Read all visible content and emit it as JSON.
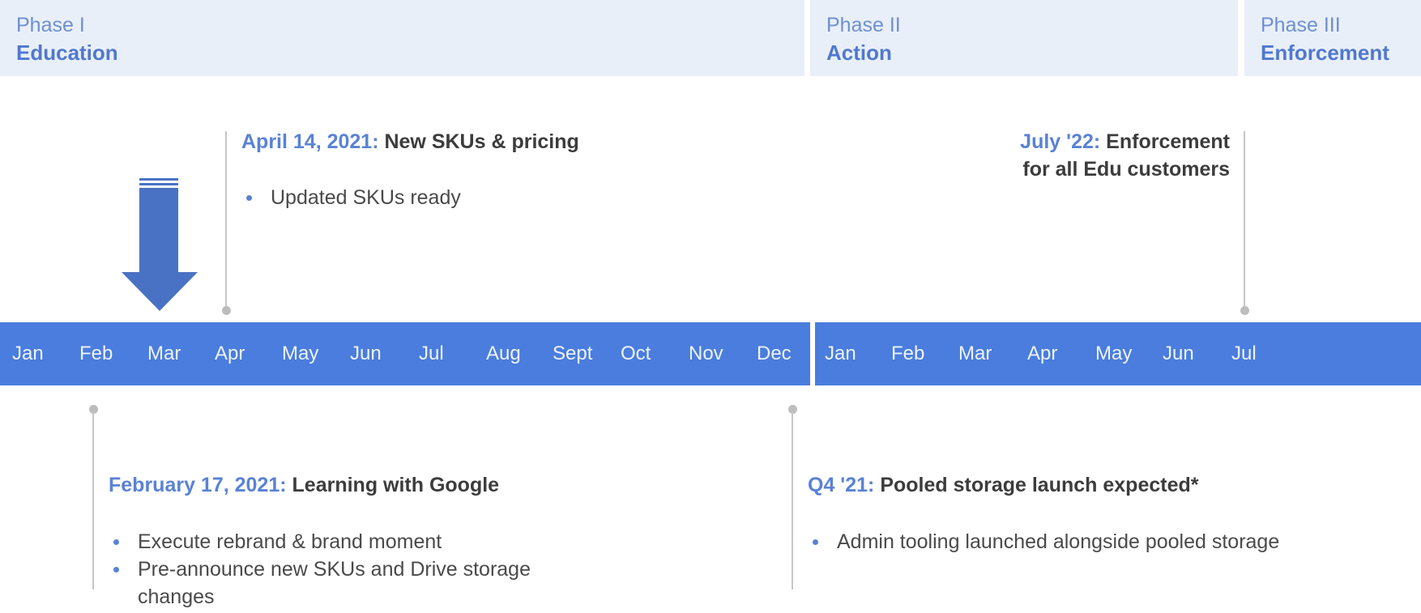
{
  "phases": [
    {
      "number": "Phase I",
      "name": "Education"
    },
    {
      "number": "Phase II",
      "name": "Action"
    },
    {
      "number": "Phase III",
      "name": "Enforcement"
    }
  ],
  "timeline": {
    "year1_months": [
      "Jan",
      "Feb",
      "Mar",
      "Apr",
      "May",
      "Jun",
      "Jul",
      "Aug",
      "Sept",
      "Oct",
      "Nov",
      "Dec"
    ],
    "year2_months": [
      "Jan",
      "Feb",
      "Mar",
      "Apr",
      "May",
      "Jun",
      "Jul"
    ],
    "bar_color": "#4a7ddd",
    "current_marker_month": "Mar"
  },
  "events": {
    "apr": {
      "date": "April 14, 2021:",
      "title": " New SKUs & pricing",
      "bullets": [
        "Updated SKUs ready"
      ]
    },
    "jul22": {
      "date": "July '22:",
      "title_line1": " Enforcement",
      "title_line2": "for all Edu customers"
    },
    "feb": {
      "date": "February 17, 2021:",
      "title": " Learning with Google",
      "bullets": [
        "Execute rebrand & brand moment",
        "Pre-announce new SKUs and Drive storage changes"
      ]
    },
    "q4": {
      "date": "Q4 '21:",
      "title": " Pooled storage launch expected*",
      "bullets": [
        "Admin tooling launched alongside pooled storage"
      ]
    }
  },
  "colors": {
    "accent": "#5a82d4",
    "phase_bg": "#e9eff8",
    "arrow": "#4a72c4"
  }
}
